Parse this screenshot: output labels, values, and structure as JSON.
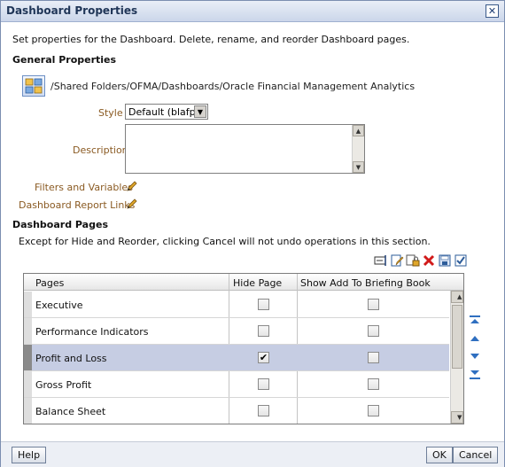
{
  "dialog": {
    "title": "Dashboard Properties",
    "close_glyph": "✕",
    "intro": "Set properties for the Dashboard. Delete, rename, and reorder Dashboard pages."
  },
  "general": {
    "heading": "General Properties",
    "path": "/Shared Folders/OFMA/Dashboards/Oracle Financial Management Analytics",
    "style_label": "Style",
    "style_value": "Default (blafp)",
    "description_label": "Description",
    "description_value": "",
    "filters_label": "Filters and Variables",
    "report_links_label": "Dashboard Report Links"
  },
  "pages": {
    "heading": "Dashboard Pages",
    "note": "Except for Hide and Reorder, clicking Cancel will not undo operations in this section.",
    "columns": [
      "Pages",
      "Hide Page",
      "Show Add To Briefing Book"
    ],
    "rows": [
      {
        "name": "Executive",
        "hide": false,
        "briefing": false,
        "selected": false
      },
      {
        "name": "Performance Indicators",
        "hide": false,
        "briefing": false,
        "selected": false
      },
      {
        "name": "Profit and Loss",
        "hide": true,
        "briefing": false,
        "selected": true
      },
      {
        "name": "Gross Profit",
        "hide": false,
        "briefing": false,
        "selected": false
      },
      {
        "name": "Balance Sheet",
        "hide": false,
        "briefing": false,
        "selected": false
      }
    ],
    "checked_glyph": "✔",
    "toolbar_icons": [
      "rename-icon",
      "properties-icon",
      "permissions-icon",
      "delete-icon",
      "save-as-icon",
      "validate-icon"
    ],
    "reorder_icons": [
      "move-to-top-icon",
      "move-up-icon",
      "move-down-icon",
      "move-to-bottom-icon"
    ]
  },
  "footer": {
    "help_label": "Help",
    "ok_label": "OK",
    "cancel_label": "Cancel"
  },
  "colors": {
    "accent": "#1d3d74",
    "label_brown": "#8a5a22",
    "selected_row": "#c6cde3"
  }
}
